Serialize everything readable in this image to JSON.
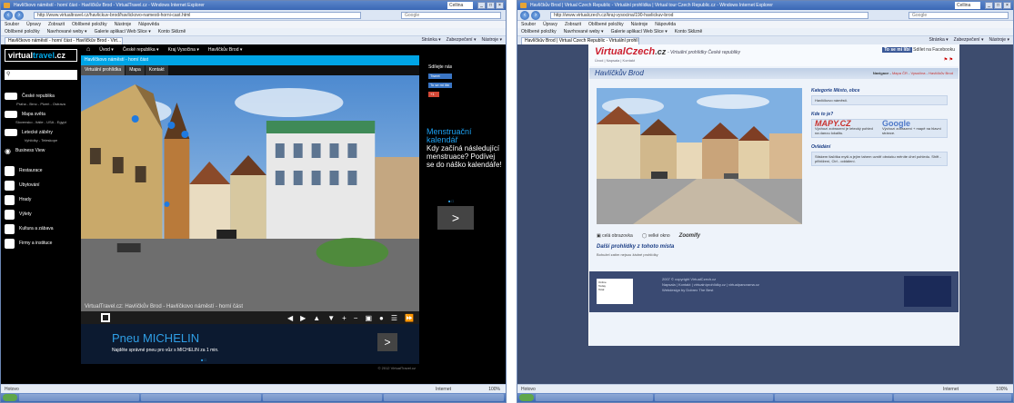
{
  "left": {
    "title": "Havlíčkovo náměstí - horní část - Havlíčkův Brod - VirtualTravel.cz - Windows Internet Explorer",
    "search": "Cellina",
    "url": "http://www.virtualtravel.cz/havlickuv-brod/havlickovo-namesti-horni-cast.html",
    "google_placeholder": "Google",
    "menu": [
      "Soubor",
      "Úpravy",
      "Zobrazit",
      "Oblíbené položky",
      "Nástroje",
      "Nápověda"
    ],
    "favs": [
      "Oblíbené položky",
      "Navrhované weby ▾",
      "Galerie aplikací Web Slice ▾",
      "Konto Sklizně"
    ],
    "tab": "Havlíčkovo náměstí - horní část - Havlíčkův Brod - Virt...",
    "tools": [
      "Stránka ▾",
      "Zabezpečení ▾",
      "Nástroje ▾"
    ],
    "site": {
      "logo_a": "virtual",
      "logo_b": "travel",
      "logo_c": ".cz",
      "nav": [
        "Úvod ▾",
        "České republika ▾",
        "Kraj Vysočina ▾",
        "Havlíčkův Brod ▾"
      ],
      "page_title": "Havlíčkovo náměstí - horní část",
      "tabs": [
        "Virtuální prohlídka",
        "Mapa",
        "Kontakt"
      ],
      "side_items": [
        {
          "label": "České republika",
          "sub": "Praha - Brno - Plzeň - Ostrava"
        },
        {
          "label": "Mapa světa",
          "sub": "Slovensko - Itálie - USA - Egypt"
        },
        {
          "label": "Letecké záběry",
          "sub": "Vyhlídky - Teleskope"
        },
        {
          "label": "Business View",
          "sub": ""
        }
      ],
      "side_cats": [
        "Restaurace",
        "Ubytování",
        "Hrady",
        "Výlety",
        "Kultura a zábava",
        "Firmy a instituce"
      ],
      "pano_caption": "VirtualTravel.cz: Havlíčkův Brod - Havlíčkovo náměstí - horní část",
      "ad_title": "Pneu MICHELIN",
      "ad_text": "Najděte správné pneu pro vůz s MICHELIN za 1 min.",
      "ad_arrow": ">",
      "share_label": "Sdílejte nás",
      "share_btn": "To se mi líbí",
      "gplus": "+1",
      "right_ad_head": "Menstruační kalendář",
      "right_ad_text": "Kdy začíná následující menstruace? Podívej se do náško kalendáře!",
      "right_arrow": ">",
      "footer_text": "© 2012 VirtualTravel.cz"
    },
    "status": "Hotovo",
    "internet": "Internet",
    "zoom": "100%"
  },
  "right": {
    "title": "Havlíčkův Brod | Virtual Czech Republic - Virtuální prohlídka | Virtual tour Czech Republic.cz - Windows Internet Explorer",
    "search": "Cellina",
    "url": "http://www.virtualczech.cz/kraj-vysocina/190-havlickuv-brod",
    "google_placeholder": "Google",
    "menu": [
      "Soubor",
      "Úpravy",
      "Zobrazit",
      "Oblíbené položky",
      "Nástroje",
      "Nápověda"
    ],
    "favs": [
      "Oblíbené položky",
      "Navrhované weby ▾",
      "Galerie aplikací Web Slice ▾",
      "Konto Sklizně"
    ],
    "tab": "Havlíčkův Brod | Virtual Czech Republic - Virtuální prohlí...",
    "tools": [
      "Stránka ▾",
      "Zabezpečení ▾",
      "Nástroje ▾"
    ],
    "site": {
      "logo_a": "VirtualCzech",
      "logo_b": ".cz",
      "tagline": "- Virtuální prohlídky České republiky",
      "crumbs": "Úvod | Napsala | Kontakt",
      "fb_btn": "To se mi líbí",
      "fb_text": "Sdílet na Facebooku",
      "title": "Havlíčkův Brod",
      "nav_prefix": "Navigace -",
      "nav_links": [
        "Mapa ČR",
        "Vysočina",
        "Havlíčkův Brod"
      ],
      "cat_head": "Kategorie  Město, obce",
      "cat_box": "Havlíčkovo náměstí.",
      "where_head": "Kde to je?",
      "mapy": "MAPY.CZ",
      "mapy_desc": "Výchozí zobrazení je letecký pohled na danou lokalitu.",
      "google": "Google",
      "google_desc": "Výchozí zobrazení + mapě na hlavní stránce.",
      "control_head": "Ovládání",
      "control_text": "Stiskem tlačítka myši a jejím tahem uvnitř obrázku měníte úhel pohledu. Shift - přiblížení, Ctrl - oddálení.",
      "tools": [
        "celá obrazovka",
        "velké okno",
        "Zoomify"
      ],
      "more_title": "Další prohlídky z tohoto místa",
      "more_text": "Bohužel zatím nejsou žádné prohlídky",
      "copy1": "2007 © copyright VirtualCzech.cz",
      "copy2": "Napsala | Kontakt | virtualníprohlídky.cz | virtualpanorama.cz",
      "copy3": "Webdesign by Dobrex  The Best",
      "stats": [
        "Online",
        "Today",
        "Total"
      ]
    },
    "status": "Hotovo",
    "internet": "Internet",
    "zoom": "100%"
  }
}
